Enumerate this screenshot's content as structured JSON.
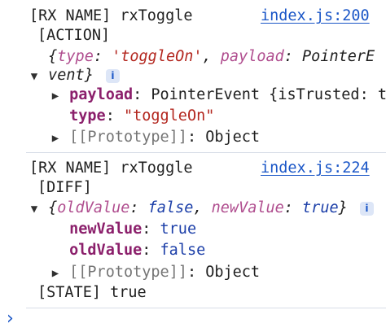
{
  "entries": [
    {
      "log_label": "[RX NAME] rxToggle",
      "source_link": "index.js:200",
      "tag": "[ACTION]",
      "object": {
        "line1": {
          "open": "{",
          "k1": "type",
          "c1": ": ",
          "v1": "'toggleOn'",
          "comma": ", ",
          "k2": "payload",
          "c2": ": ",
          "v2": "PointerE"
        },
        "line2": {
          "v2_cont": "vent",
          "close": "}"
        },
        "info_badge": "i",
        "props": [
          {
            "key": "payload",
            "colon": ": ",
            "value": "PointerEvent {isTrusted: t"
          },
          {
            "key": "type",
            "colon": ": ",
            "value": "\"toggleOn\""
          }
        ],
        "prototype": {
          "label": "[[Prototype]]",
          "colon": ": ",
          "value": "Object"
        }
      }
    },
    {
      "log_label": "[RX NAME] rxToggle",
      "source_link": "index.js:224",
      "tag": "[DIFF]",
      "object": {
        "line1": {
          "open": "{",
          "k1": "oldValue",
          "c1": ": ",
          "v1": "false",
          "comma": ", ",
          "k2": "newValue",
          "c2": ": ",
          "v2": "true",
          "close": "}"
        },
        "info_badge": "i",
        "props": [
          {
            "key": "newValue",
            "colon": ": ",
            "value": "true"
          },
          {
            "key": "oldValue",
            "colon": ": ",
            "value": "false"
          }
        ],
        "prototype": {
          "label": "[[Prototype]]",
          "colon": ": ",
          "value": "Object"
        }
      },
      "state_line": "[STATE] true"
    }
  ],
  "console": {
    "prompt_icon": "chevron-right-icon",
    "prompt_glyph": "›"
  },
  "colors": {
    "link": "#1a56c7",
    "key": "#8b1f6b",
    "string": "#b3261e",
    "boolean": "#1b3ea8",
    "separator": "#d8dee8"
  }
}
